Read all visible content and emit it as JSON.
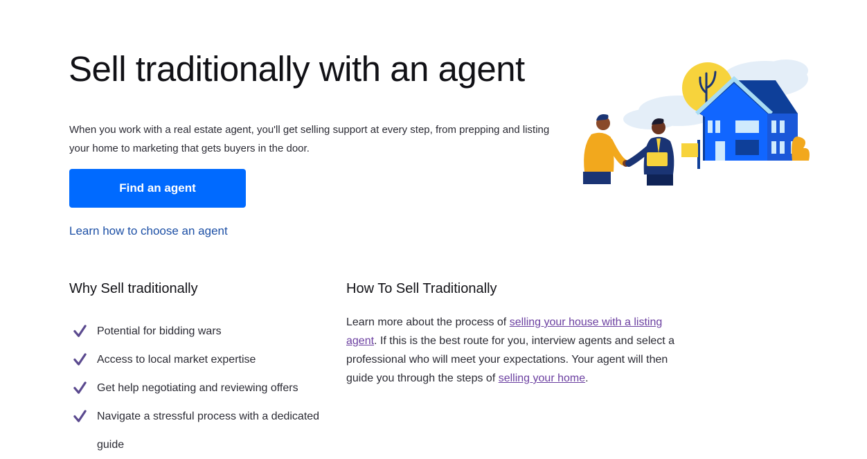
{
  "hero": {
    "title": "Sell traditionally with an agent",
    "description": "When you work with a real estate agent, you'll get selling support at every step, from prepping and listing your home to marketing that gets buyers in the door.",
    "cta_label": "Find an agent",
    "learn_link": "Learn how to choose an agent"
  },
  "why": {
    "heading": "Why Sell traditionally",
    "items": [
      "Potential for bidding wars",
      "Access to local market expertise",
      "Get help negotiating and reviewing offers",
      "Navigate a stressful process with a dedicated guide"
    ]
  },
  "how": {
    "heading": "How To Sell Traditionally",
    "text_1": "Learn more about the process of ",
    "link_1": "selling your house with a listing agent",
    "text_2": ". If this is the best route for you, interview agents and select a professional who will meet your expectations. Your agent will then guide you through the steps of ",
    "link_2": "selling your home",
    "text_3": "."
  },
  "icons": {
    "check": "check-icon",
    "illustration": "agent-handshake-house-illustration"
  },
  "colors": {
    "primary_button": "#006aff",
    "link": "#1c4fa5",
    "visited_link": "#6b3fa0",
    "check": "#5b4a8f"
  }
}
